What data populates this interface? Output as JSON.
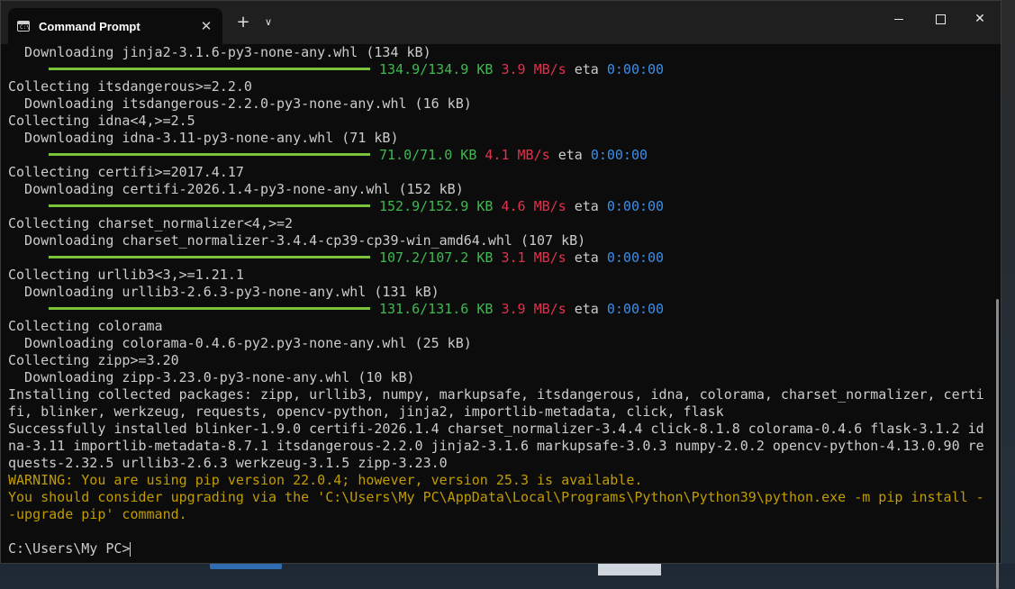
{
  "window": {
    "tab_title": "Command Prompt",
    "tab_icon": "cmd-icon",
    "tab_close_glyph": "✕",
    "new_tab_glyph": "+",
    "dropdown_glyph": "∨",
    "close_glyph": "✕"
  },
  "colors": {
    "background": "#0c0c0c",
    "text": "#cccccc",
    "progress": "#7cc13a",
    "green": "#3fb950",
    "red": "#e0324d",
    "cyan": "#3b8eea",
    "warning": "#c19c00"
  },
  "terminal": {
    "lines": [
      {
        "kind": "text",
        "text": "  Downloading jinja2-3.1.6-py3-none-any.whl (134 kB)"
      },
      {
        "kind": "progress",
        "size": "134.9/134.9 KB",
        "speed": "3.9 MB/s",
        "eta_label": "eta",
        "eta": "0:00:00",
        "fraction": 1.0
      },
      {
        "kind": "text",
        "text": "Collecting itsdangerous>=2.2.0"
      },
      {
        "kind": "text",
        "text": "  Downloading itsdangerous-2.2.0-py3-none-any.whl (16 kB)"
      },
      {
        "kind": "text",
        "text": "Collecting idna<4,>=2.5"
      },
      {
        "kind": "text",
        "text": "  Downloading idna-3.11-py3-none-any.whl (71 kB)"
      },
      {
        "kind": "progress",
        "size": "71.0/71.0 KB",
        "speed": "4.1 MB/s",
        "eta_label": "eta",
        "eta": "0:00:00",
        "fraction": 1.0
      },
      {
        "kind": "text",
        "text": "Collecting certifi>=2017.4.17"
      },
      {
        "kind": "text",
        "text": "  Downloading certifi-2026.1.4-py3-none-any.whl (152 kB)"
      },
      {
        "kind": "progress",
        "size": "152.9/152.9 KB",
        "speed": "4.6 MB/s",
        "eta_label": "eta",
        "eta": "0:00:00",
        "fraction": 1.0
      },
      {
        "kind": "text",
        "text": "Collecting charset_normalizer<4,>=2"
      },
      {
        "kind": "text",
        "text": "  Downloading charset_normalizer-3.4.4-cp39-cp39-win_amd64.whl (107 kB)"
      },
      {
        "kind": "progress",
        "size": "107.2/107.2 KB",
        "speed": "3.1 MB/s",
        "eta_label": "eta",
        "eta": "0:00:00",
        "fraction": 1.0
      },
      {
        "kind": "text",
        "text": "Collecting urllib3<3,>=1.21.1"
      },
      {
        "kind": "text",
        "text": "  Downloading urllib3-2.6.3-py3-none-any.whl (131 kB)"
      },
      {
        "kind": "progress",
        "size": "131.6/131.6 KB",
        "speed": "3.9 MB/s",
        "eta_label": "eta",
        "eta": "0:00:00",
        "fraction": 1.0
      },
      {
        "kind": "text",
        "text": "Collecting colorama"
      },
      {
        "kind": "text",
        "text": "  Downloading colorama-0.4.6-py2.py3-none-any.whl (25 kB)"
      },
      {
        "kind": "text",
        "text": "Collecting zipp>=3.20"
      },
      {
        "kind": "text",
        "text": "  Downloading zipp-3.23.0-py3-none-any.whl (10 kB)"
      },
      {
        "kind": "text",
        "text": "Installing collected packages: zipp, urllib3, numpy, markupsafe, itsdangerous, idna, colorama, charset_normalizer, certi"
      },
      {
        "kind": "text",
        "text": "fi, blinker, werkzeug, requests, opencv-python, jinja2, importlib-metadata, click, flask"
      },
      {
        "kind": "text",
        "text": "Successfully installed blinker-1.9.0 certifi-2026.1.4 charset_normalizer-3.4.4 click-8.1.8 colorama-0.4.6 flask-3.1.2 id"
      },
      {
        "kind": "text",
        "text": "na-3.11 importlib-metadata-8.7.1 itsdangerous-2.2.0 jinja2-3.1.6 markupsafe-3.0.3 numpy-2.0.2 opencv-python-4.13.0.90 re"
      },
      {
        "kind": "text",
        "text": "quests-2.32.5 urllib3-2.6.3 werkzeug-3.1.5 zipp-3.23.0"
      },
      {
        "kind": "warning",
        "text": "WARNING: You are using pip version 22.0.4; however, version 25.3 is available."
      },
      {
        "kind": "warning",
        "text": "You should consider upgrading via the 'C:\\Users\\My PC\\AppData\\Local\\Programs\\Python\\Python39\\python.exe -m pip install -"
      },
      {
        "kind": "warning",
        "text": "-upgrade pip' command."
      },
      {
        "kind": "text",
        "text": ""
      },
      {
        "kind": "prompt",
        "text": "C:\\Users\\My PC>"
      }
    ]
  }
}
